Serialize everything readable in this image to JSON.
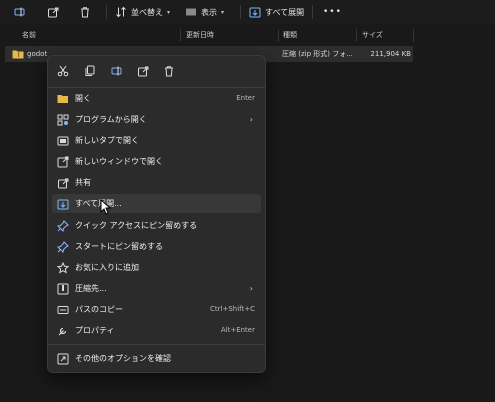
{
  "toolbar": {
    "sort_label": "並べ替え",
    "view_label": "表示",
    "extract_all_label": "すべて展開",
    "more_label": "•••"
  },
  "columns": {
    "name": "名前",
    "date": "更新日時",
    "type": "種類",
    "size": "サイズ"
  },
  "file": {
    "name": "godot",
    "type": "圧縮 (zip 形式) フォ...",
    "size": "211,904 KB"
  },
  "menu": {
    "items": [
      {
        "label": "開く",
        "shortcut": "Enter",
        "icon": "folder-open-icon"
      },
      {
        "label": "プログラムから開く",
        "submenu": true,
        "icon": "open-with-icon"
      },
      {
        "label": "新しいタブで開く",
        "icon": "new-tab-icon"
      },
      {
        "label": "新しいウィンドウで開く",
        "icon": "new-window-icon"
      },
      {
        "label": "共有",
        "icon": "share-icon"
      },
      {
        "label": "すべて展開...",
        "icon": "extract-icon"
      },
      {
        "label": "クイック アクセスにピン留めする",
        "icon": "pin-icon"
      },
      {
        "label": "スタートにピン留めする",
        "icon": "pin-icon"
      },
      {
        "label": "お気に入りに追加",
        "icon": "star-icon"
      },
      {
        "label": "圧縮先...",
        "submenu": true,
        "icon": "compress-icon"
      },
      {
        "label": "パスのコピー",
        "shortcut": "Ctrl+Shift+C",
        "icon": "copy-path-icon"
      },
      {
        "label": "プロパティ",
        "shortcut": "Alt+Enter",
        "icon": "properties-icon"
      },
      {
        "label": "その他のオプションを確認",
        "icon": "more-options-icon"
      }
    ],
    "submenu_arrow": "›"
  }
}
